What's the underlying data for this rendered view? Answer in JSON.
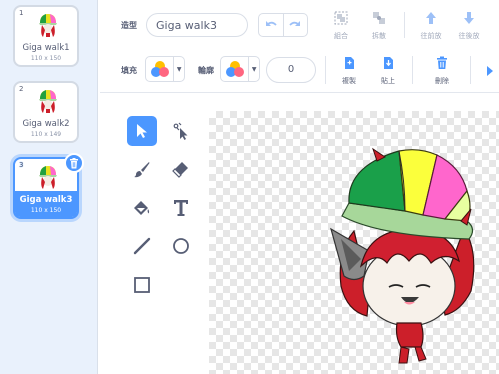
{
  "costumes": [
    {
      "number": "1",
      "name": "Giga walk1",
      "size": "110 x 150",
      "selected": false
    },
    {
      "number": "2",
      "name": "Giga walk2",
      "size": "110 x 149",
      "selected": false
    },
    {
      "number": "3",
      "name": "Giga walk3",
      "size": "110 x 150",
      "selected": true
    }
  ],
  "toolbar": {
    "costume_label": "造型",
    "costume_name": "Giga walk3",
    "group_label": "組合",
    "ungroup_label": "拆散",
    "forward_label": "往前放",
    "backward_label": "往後放",
    "fill_label": "填充",
    "outline_label": "輪廓",
    "outline_width": "0",
    "copy_label": "複製",
    "paste_label": "貼上",
    "delete_label": "刪除"
  },
  "colors": {
    "accent": "#4c97ff",
    "sidebar_bg": "#e9f1fc",
    "text": "#575e75"
  },
  "tools": [
    "select-tool",
    "reshape-tool",
    "brush-tool",
    "eraser-tool",
    "fill-tool",
    "text-tool",
    "line-tool",
    "circle-tool",
    "rectangle-tool"
  ]
}
